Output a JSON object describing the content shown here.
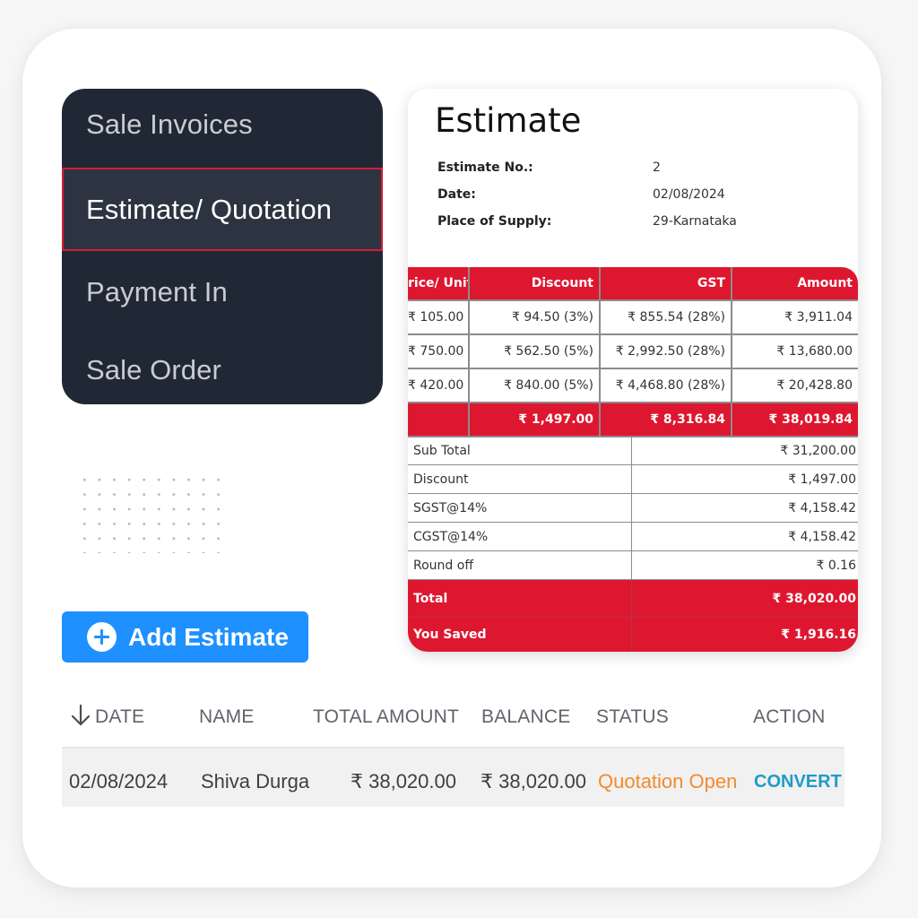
{
  "menu": {
    "items": [
      {
        "label": "Sale Invoices",
        "active": false
      },
      {
        "label": "Estimate/ Quotation",
        "active": true
      },
      {
        "label": "Payment In",
        "active": false
      },
      {
        "label": "Sale Order",
        "active": false
      }
    ]
  },
  "add_button": {
    "label": "Add Estimate",
    "icon": "plus-circle-icon"
  },
  "list": {
    "sort_icon": "arrow-down-icon",
    "columns": [
      "DATE",
      "NAME",
      "TOTAL AMOUNT",
      "BALANCE",
      "STATUS",
      "ACTION"
    ],
    "rows": [
      {
        "date": "02/08/2024",
        "name": "Shiva Durga",
        "total_amount": "₹ 38,020.00",
        "balance": "₹ 38,020.00",
        "status": "Quotation Open",
        "action": "CONVERT"
      }
    ]
  },
  "estimate": {
    "title": "Estimate",
    "meta": [
      {
        "label": "Estimate No.:",
        "value": "2"
      },
      {
        "label": "Date:",
        "value": "02/08/2024"
      },
      {
        "label": "Place of Supply:",
        "value": "29-Karnataka"
      }
    ],
    "items_table": {
      "headers": [
        "rice/ Unit",
        "Discount",
        "GST",
        "Amount"
      ],
      "rows": [
        [
          "₹ 105.00",
          "₹ 94.50 (3%)",
          "₹ 855.54 (28%)",
          "₹ 3,911.04"
        ],
        [
          "₹ 750.00",
          "₹ 562.50 (5%)",
          "₹ 2,992.50 (28%)",
          "₹ 13,680.00"
        ],
        [
          "₹ 420.00",
          "₹ 840.00 (5%)",
          "₹ 4,468.80 (28%)",
          "₹ 20,428.80"
        ]
      ],
      "totals": [
        "",
        "₹ 1,497.00",
        "₹ 8,316.84",
        "₹ 38,019.84"
      ]
    },
    "summary": [
      {
        "label": "Sub Total",
        "value": "₹ 31,200.00"
      },
      {
        "label": "Discount",
        "value": "₹ 1,497.00"
      },
      {
        "label": "SGST@14%",
        "value": "₹ 4,158.42"
      },
      {
        "label": "CGST@14%",
        "value": "₹ 4,158.42"
      },
      {
        "label": "Round off",
        "value": "₹ 0.16"
      },
      {
        "label": "Total",
        "value": "₹ 38,020.00",
        "highlight": true
      },
      {
        "label": "You Saved",
        "value": "₹ 1,916.16",
        "highlight": true
      }
    ]
  },
  "colors": {
    "menu_bg": "#212835",
    "active_border": "#d31c33",
    "accent_blue": "#1e90ff",
    "table_red": "#de1730",
    "status_orange": "#f28a2e",
    "convert_blue": "#1e9bc9"
  }
}
